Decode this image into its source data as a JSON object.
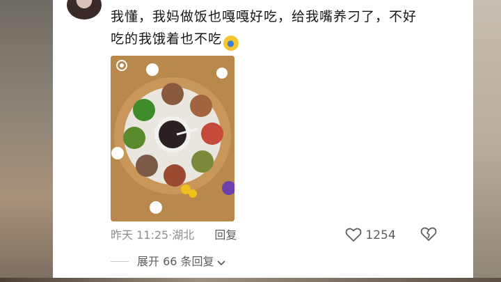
{
  "comment": {
    "text_line1": "我懂，我妈做饭也嘎嘎好吃，给我嘴养刁了，不好",
    "text_line2": "吃的我饿着也不吃",
    "emoji": "😭"
  },
  "meta": {
    "time": "昨天 11:25",
    "separator": "·",
    "location": "湖北",
    "reply_label": "回复"
  },
  "actions": {
    "like_count": "1254"
  },
  "replies": {
    "expand_label": "展开 66 条回复"
  }
}
